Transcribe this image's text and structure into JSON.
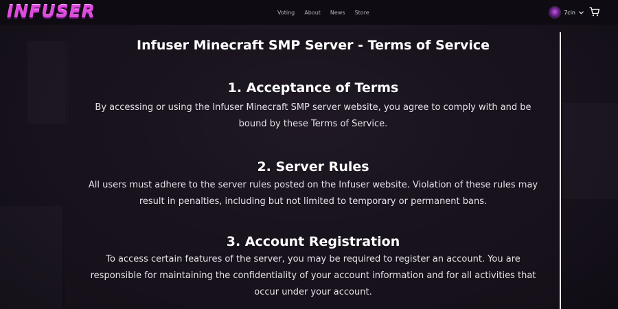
{
  "header": {
    "logo_text": "INFUSER",
    "nav": [
      "Voting",
      "About",
      "News",
      "Store"
    ],
    "username": "7cin"
  },
  "document": {
    "title": "Infuser Minecraft SMP Server - Terms of Service",
    "sections": [
      {
        "heading": "1. Acceptance of Terms",
        "body": "By accessing or using the Infuser Minecraft SMP server website, you agree to comply with and be bound by these Terms of Service."
      },
      {
        "heading": "2. Server Rules",
        "body": "All users must adhere to the server rules posted on the Infuser website. Violation of these rules may result in penalties, including but not limited to temporary or permanent bans."
      },
      {
        "heading": "3. Account Registration",
        "body": "To access certain features of the server, you may be required to register an account. You are responsible for maintaining the confidentiality of your account information and for all activities that occur under your account."
      }
    ]
  },
  "colors": {
    "logo": "#e04bdd",
    "background": "#14101a",
    "navbar": "#0f0b12",
    "text": "#ffffff"
  }
}
